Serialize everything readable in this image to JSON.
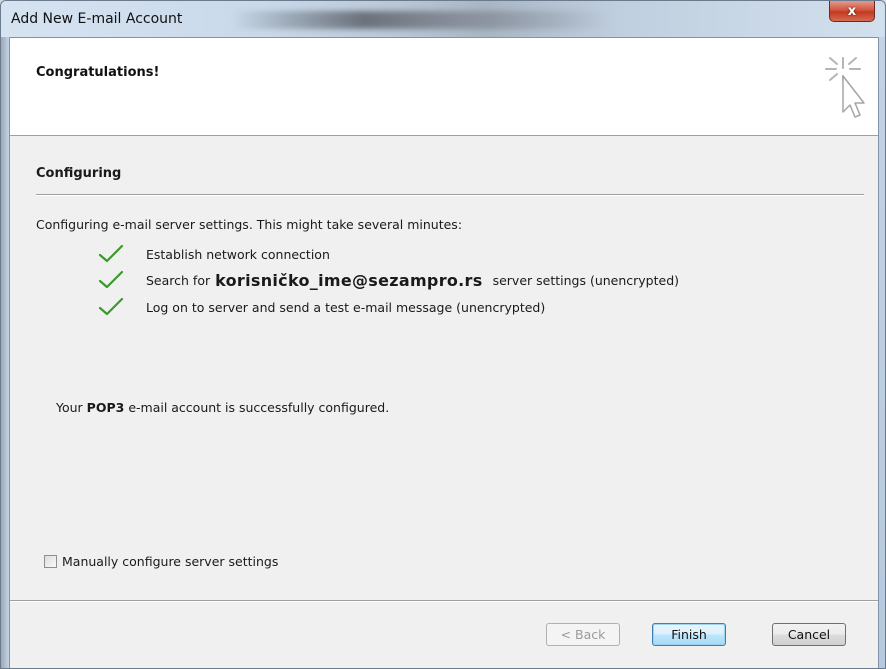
{
  "window": {
    "title": "Add New E-mail Account",
    "close_label": "x"
  },
  "header": {
    "title": "Congratulations!",
    "icon": "wizard-cursor-icon"
  },
  "section": {
    "title": "Configuring",
    "intro": "Configuring e-mail server settings. This might take several minutes:"
  },
  "steps": [
    {
      "label": "Establish network connection",
      "status": "done"
    },
    {
      "prefix": "Search for",
      "email": "korisničko_ime@sezampro.rs",
      "suffix": "server settings (unencrypted)",
      "status": "done"
    },
    {
      "label": "Log on to server and send a test e-mail message (unencrypted)",
      "status": "done"
    }
  ],
  "result": {
    "prefix": "Your",
    "protocol": "POP3",
    "suffix": "e-mail account is successfully configured."
  },
  "manual": {
    "label": "Manually configure server settings",
    "checked": false
  },
  "buttons": {
    "back": "< Back",
    "finish": "Finish",
    "cancel": "Cancel"
  },
  "colors": {
    "check": "#3a9a2a",
    "finish_border": "#3c7fb1",
    "close": "#c23a22"
  }
}
